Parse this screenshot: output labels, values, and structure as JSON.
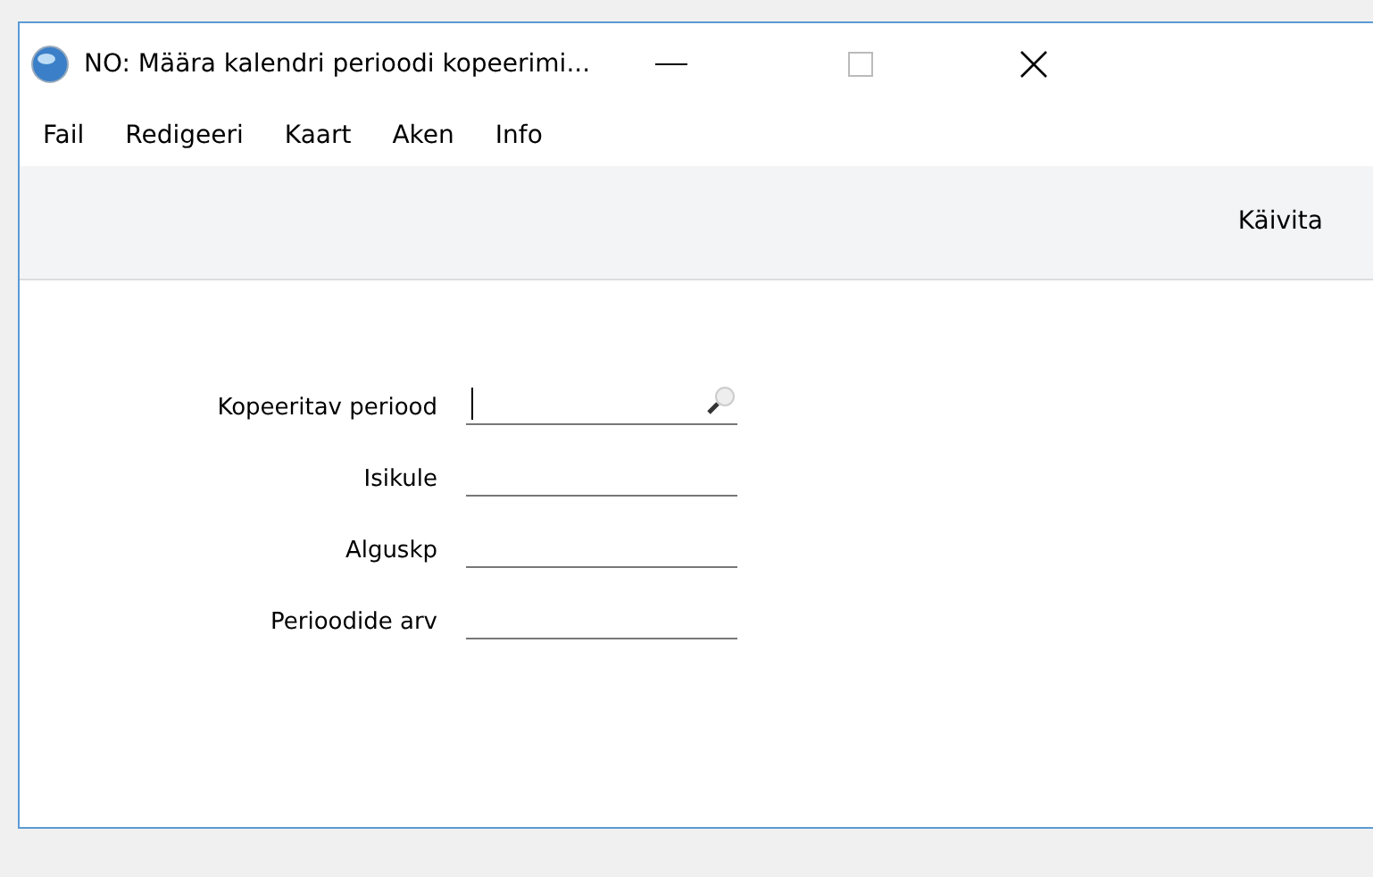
{
  "window": {
    "title": "NO: Määra kalendri perioodi kopeerimi..."
  },
  "menu": [
    "Fail",
    "Redigeeri",
    "Kaart",
    "Aken",
    "Info"
  ],
  "toolbar": {
    "buttons": [
      "Käivita"
    ]
  },
  "fields": [
    {
      "label": "Kopeeritav periood",
      "focused": true,
      "lookup": true
    },
    {
      "label": "Isikule",
      "focused": false,
      "lookup": false
    },
    {
      "label": "Alguskp",
      "focused": false,
      "lookup": false
    },
    {
      "label": "Perioodide arv",
      "focused": false,
      "lookup": false
    }
  ]
}
